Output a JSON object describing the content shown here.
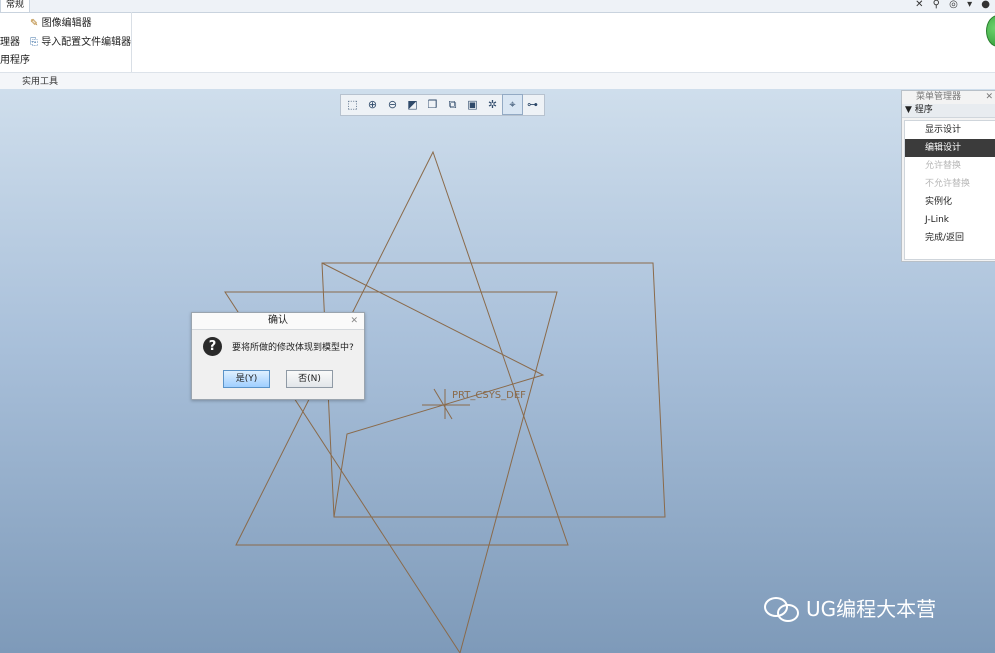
{
  "ribbon": {
    "tab_general": "常规",
    "tb_right_icons": "✕ ⚲ ◎ ▾ ●",
    "items": {
      "image_editor": "图像编辑器",
      "manager_partial": "理器",
      "import_config_editor": "导入配置文件编辑器",
      "program_partial": "用程序"
    },
    "group_label": "实用工具"
  },
  "view_toolbar": {
    "buttons": [
      {
        "name": "refit-icon",
        "glyph": "⬚"
      },
      {
        "name": "zoom-in-icon",
        "glyph": "⊕"
      },
      {
        "name": "zoom-out-icon",
        "glyph": "⊖"
      },
      {
        "name": "repaint-icon",
        "glyph": "◩"
      },
      {
        "name": "display-style-icon",
        "glyph": "❒"
      },
      {
        "name": "saved-views-icon",
        "glyph": "⧉"
      },
      {
        "name": "view-manager-icon",
        "glyph": "▣"
      },
      {
        "name": "datum-display-icon",
        "glyph": "✲"
      },
      {
        "name": "csys-display-icon",
        "glyph": "⌖"
      },
      {
        "name": "spin-center-icon",
        "glyph": "⊶"
      }
    ]
  },
  "menu_manager": {
    "title": "菜单管理器",
    "section": "程序",
    "items": [
      {
        "label": "显示设计",
        "state": "normal"
      },
      {
        "label": "编辑设计",
        "state": "selected"
      },
      {
        "label": "允许替换",
        "state": "disabled"
      },
      {
        "label": "不允许替换",
        "state": "disabled"
      },
      {
        "label": "实例化",
        "state": "normal"
      },
      {
        "label": "J-Link",
        "state": "normal"
      },
      {
        "label": "完成/返回",
        "state": "normal"
      }
    ]
  },
  "dialog": {
    "title": "确认",
    "message": "要将所做的修改体现到模型中?",
    "icon_glyph": "?",
    "yes_label": "是(Y)",
    "no_label": "否(N)"
  },
  "geometry": {
    "csys_label": "PRT_CSYS_DEF",
    "line_color": "#8a6a4a"
  },
  "watermark": {
    "text": "UG编程大本营"
  }
}
